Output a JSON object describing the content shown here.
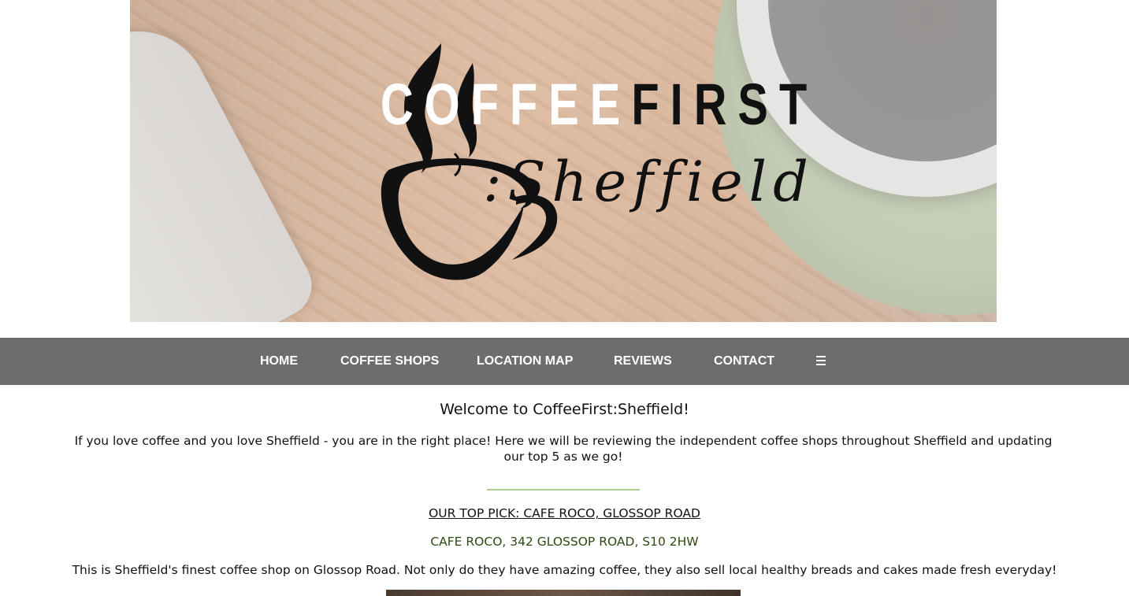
{
  "banner": {
    "title_part1": "COFFEE",
    "title_part2": "FIRST",
    "subtitle": ":Sheffield",
    "logo_icon": "coffee-cup-icon"
  },
  "nav": {
    "items": [
      "HOME",
      "COFFEE SHOPS",
      "LOCATION MAP",
      "REVIEWS",
      "CONTACT"
    ],
    "menu_icon": "hamburger-menu-icon",
    "background": "#6d6d6d"
  },
  "main": {
    "welcome": "Welcome to CoffeeFirst:Sheffield!",
    "intro": "If you love coffee and you love Sheffield - you are in the right place! Here we will be reviewing the independent coffee shops throughout Sheffield and updating our top 5 as we go!",
    "top_pick_heading": "OUR TOP PICK: CAFE ROCO, GLOSSOP ROAD",
    "address": "CAFE ROCO, 342 GLOSSOP ROAD, S10 2HW",
    "description": "This is Sheffield's finest coffee shop on Glossop Road. Not only do they have amazing coffee, they also sell local healthy breads and cakes made fresh everyday!",
    "divider_color": "#a8cf8e",
    "address_color": "#2e4a12"
  }
}
